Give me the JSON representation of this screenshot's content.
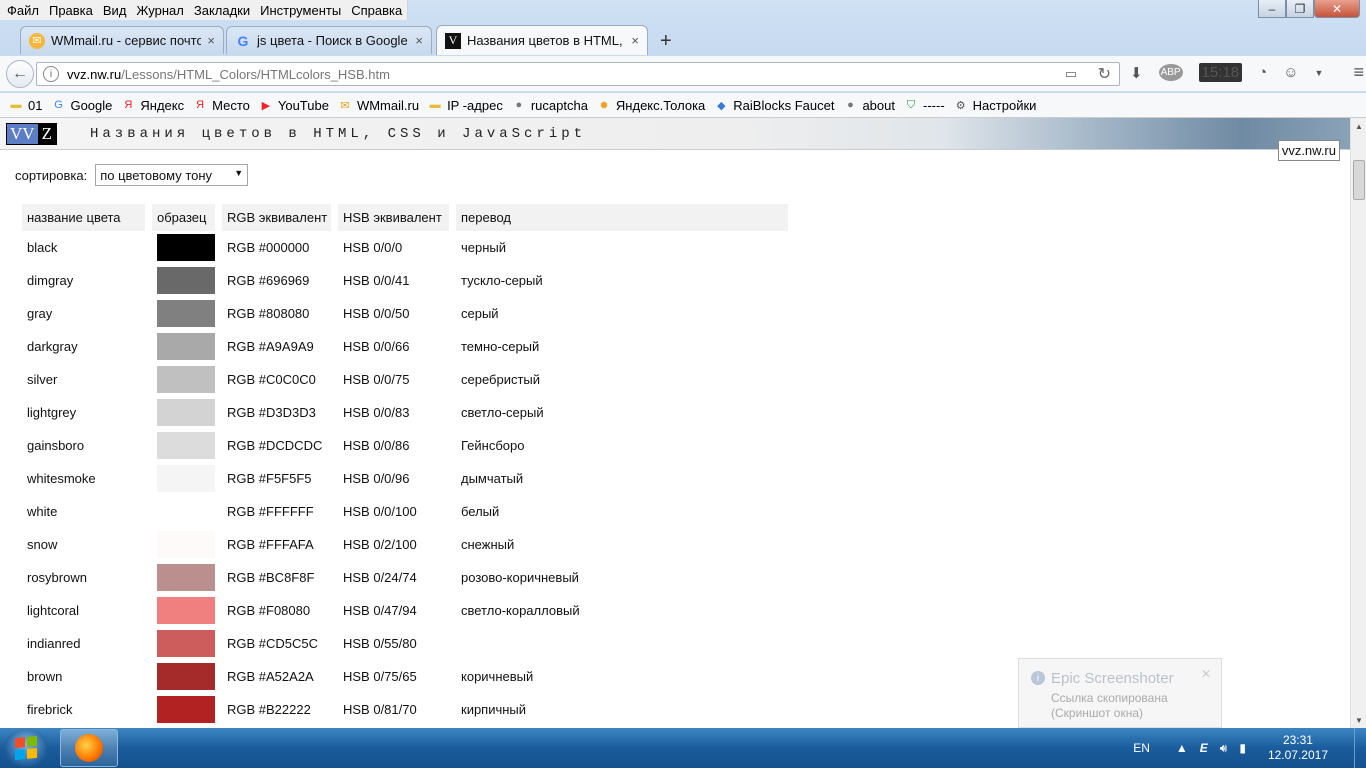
{
  "menubar": [
    "Файл",
    "Правка",
    "Вид",
    "Журнал",
    "Закладки",
    "Инструменты",
    "Справка"
  ],
  "tabs": [
    {
      "label": "WMmail.ru - сервис почтовых",
      "icon": "wmmail-icon",
      "close": "×"
    },
    {
      "label": "js цвета - Поиск в Google",
      "icon": "google-icon",
      "close": "×"
    },
    {
      "label": "Названия цветов в HTML, CSS",
      "icon": "vvz-icon",
      "close": "×"
    }
  ],
  "newtab": "+",
  "urlbar": {
    "host": "vvz.nw.ru",
    "path": "/Lessons/HTML_Colors/HTMLcolors_HSB.htm"
  },
  "nav_clock": "15:18",
  "bookmarks": [
    {
      "label": "01",
      "icon": "folder-icon"
    },
    {
      "label": "Google",
      "icon": "google-icon"
    },
    {
      "label": "Яндекс",
      "icon": "yandex-icon"
    },
    {
      "label": "Место",
      "icon": "yandex-icon"
    },
    {
      "label": "YouTube",
      "icon": "youtube-icon"
    },
    {
      "label": "WMmail.ru",
      "icon": "wmmail-icon"
    },
    {
      "label": "IP -адрес",
      "icon": "folder-icon"
    },
    {
      "label": "rucaptcha",
      "icon": "globe-icon"
    },
    {
      "label": "Яндекс.Толока",
      "icon": "toloka-icon"
    },
    {
      "label": "RaiBlocks Faucet",
      "icon": "raiblocks-icon"
    },
    {
      "label": "about",
      "icon": "globe-icon"
    },
    {
      "label": "-----",
      "icon": "shield-icon"
    },
    {
      "label": "Настройки",
      "icon": "gear-icon"
    }
  ],
  "page": {
    "logo_left": "VV",
    "logo_right": "Z",
    "title": "Названия цветов в HTML, CSS и JavaScript",
    "site_link": "vvz.nw.ru",
    "sort_label": "сортировка:",
    "sort_value": "по цветовому тону",
    "headers": [
      "название цвета",
      "образец",
      "RGB эквивалент",
      "HSB эквивалент",
      "перевод"
    ],
    "rows": [
      {
        "name": "black",
        "hex": "#000000",
        "rgb": "RGB #000000",
        "hsb": "HSB 0/0/0",
        "translation": "черный"
      },
      {
        "name": "dimgray",
        "hex": "#696969",
        "rgb": "RGB #696969",
        "hsb": "HSB 0/0/41",
        "translation": "тускло-серый"
      },
      {
        "name": "gray",
        "hex": "#808080",
        "rgb": "RGB #808080",
        "hsb": "HSB 0/0/50",
        "translation": "серый"
      },
      {
        "name": "darkgray",
        "hex": "#A9A9A9",
        "rgb": "RGB #A9A9A9",
        "hsb": "HSB 0/0/66",
        "translation": "темно-серый"
      },
      {
        "name": "silver",
        "hex": "#C0C0C0",
        "rgb": "RGB #C0C0C0",
        "hsb": "HSB 0/0/75",
        "translation": "серебристый"
      },
      {
        "name": "lightgrey",
        "hex": "#D3D3D3",
        "rgb": "RGB #D3D3D3",
        "hsb": "HSB 0/0/83",
        "translation": "светло-серый"
      },
      {
        "name": "gainsboro",
        "hex": "#DCDCDC",
        "rgb": "RGB #DCDCDC",
        "hsb": "HSB 0/0/86",
        "translation": "Гейнсборо"
      },
      {
        "name": "whitesmoke",
        "hex": "#F5F5F5",
        "rgb": "RGB #F5F5F5",
        "hsb": "HSB 0/0/96",
        "translation": "дымчатый"
      },
      {
        "name": "white",
        "hex": "#FFFFFF",
        "rgb": "RGB #FFFFFF",
        "hsb": "HSB 0/0/100",
        "translation": "белый"
      },
      {
        "name": "snow",
        "hex": "#FFFAFA",
        "rgb": "RGB #FFFAFA",
        "hsb": "HSB 0/2/100",
        "translation": "снежный"
      },
      {
        "name": "rosybrown",
        "hex": "#BC8F8F",
        "rgb": "RGB #BC8F8F",
        "hsb": "HSB 0/24/74",
        "translation": "розово-коричневый"
      },
      {
        "name": "lightcoral",
        "hex": "#F08080",
        "rgb": "RGB #F08080",
        "hsb": "HSB 0/47/94",
        "translation": "светло-коралловый"
      },
      {
        "name": "indianred",
        "hex": "#CD5C5C",
        "rgb": "RGB #CD5C5C",
        "hsb": "HSB 0/55/80",
        "translation": ""
      },
      {
        "name": "brown",
        "hex": "#A52A2A",
        "rgb": "RGB #A52A2A",
        "hsb": "HSB 0/75/65",
        "translation": "коричневый"
      },
      {
        "name": "firebrick",
        "hex": "#B22222",
        "rgb": "RGB #B22222",
        "hsb": "HSB 0/81/70",
        "translation": "кирпичный"
      }
    ]
  },
  "notification": {
    "title": "Epic Screenshoter",
    "line1": "Ссылка скопирована",
    "line2": "(Скриншот окна)"
  },
  "taskbar": {
    "lang": "EN",
    "time": "23:31",
    "date": "12.07.2017"
  }
}
